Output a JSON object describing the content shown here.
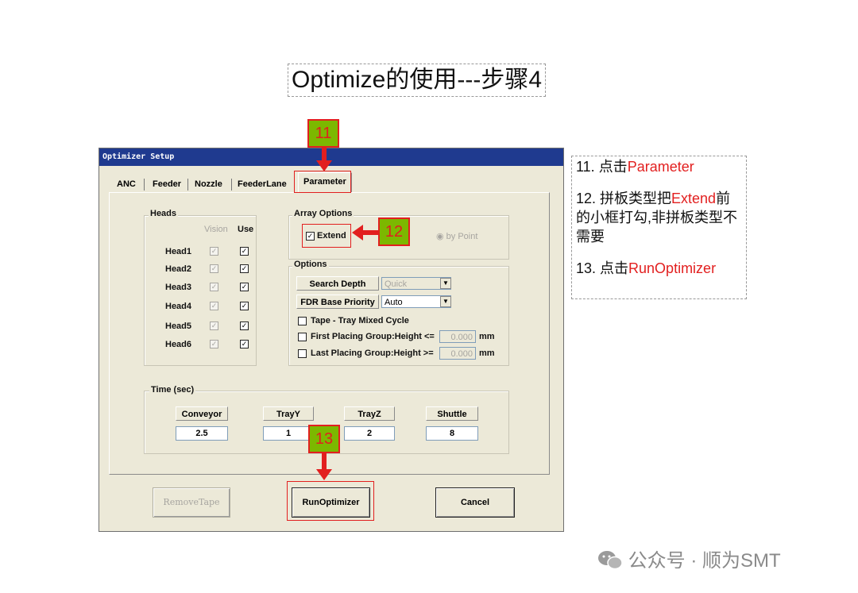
{
  "slide": {
    "title": "Optimize的使用---步骤4"
  },
  "dialog": {
    "title": "Optimizer Setup",
    "tabs": [
      "ANC",
      "Feeder",
      "Nozzle",
      "FeederLane"
    ],
    "active_tab": "Parameter",
    "heads": {
      "group_title": "Heads",
      "col_vision": "Vision",
      "col_use": "Use",
      "rows": [
        {
          "label": "Head1",
          "vision": "☑",
          "use": "☑"
        },
        {
          "label": "Head2",
          "vision": "☑",
          "use": "☑"
        },
        {
          "label": "Head3",
          "vision": "☑",
          "use": "☑"
        },
        {
          "label": "Head4",
          "vision": "☑",
          "use": "☑"
        },
        {
          "label": "Head5",
          "vision": "☑",
          "use": "☑"
        },
        {
          "label": "Head6",
          "vision": "☑",
          "use": "☑"
        }
      ]
    },
    "array_options": {
      "group_title": "Array Options",
      "extend_label": "Extend",
      "extend_checked": "✓",
      "by_point_label": "by Point"
    },
    "options": {
      "group_title": "Options",
      "search_depth_label": "Search Depth",
      "search_depth_value": "Quick",
      "fdr_label": "FDR Base Priority",
      "fdr_value": "Auto",
      "tape_tray_label": "Tape - Tray Mixed Cycle",
      "first_group_label": "First Placing Group:Height <=",
      "first_group_value": "0.000",
      "last_group_label": "Last Placing Group:Height >=",
      "last_group_value": "0.000",
      "unit": "mm"
    },
    "time": {
      "group_title": "Time (sec)",
      "columns": [
        {
          "label": "Conveyor",
          "value": "2.5"
        },
        {
          "label": "TrayY",
          "value": "1"
        },
        {
          "label": "TrayZ",
          "value": "2"
        },
        {
          "label": "Shuttle",
          "value": "8"
        }
      ]
    },
    "buttons": {
      "remove_tape": "RemoveTape",
      "run_optimizer": "RunOptimizer",
      "cancel": "Cancel"
    }
  },
  "callouts": [
    "11",
    "12",
    "13"
  ],
  "notes": {
    "n11_prefix": "11. 点击",
    "n11_highlight": "Parameter",
    "n12_prefix": "12. 拼板类型把",
    "n12_highlight": "Extend",
    "n12_rest": "前的小框打勾,非拼板类型不需要",
    "n13_prefix": "13. 点击",
    "n13_highlight": "RunOptimizer"
  },
  "watermark": "公众号 · 顺为SMT",
  "colors": {
    "accent_red": "#e21f1f",
    "callout_green": "#7cb800",
    "titlebar_blue": "#1f3a8f",
    "dialog_bg": "#ece9d8"
  }
}
